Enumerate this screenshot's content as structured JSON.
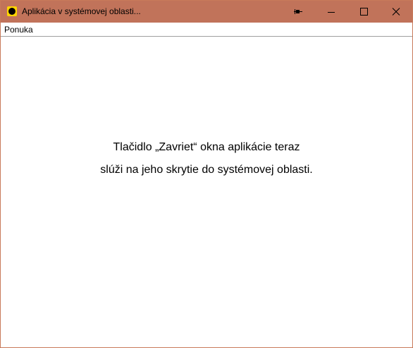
{
  "window": {
    "title": "Aplikácia v systémovej oblasti...",
    "title_bar_color": "#c1735a",
    "controls": [
      "pin-icon",
      "minimize-icon",
      "maximize-icon",
      "close-icon"
    ]
  },
  "menubar": {
    "items": [
      {
        "label": "Ponuka"
      }
    ]
  },
  "content": {
    "message_line_1": "Tlačidlo „Zavriet“ okna aplikácie teraz",
    "message_line_2": "slúži na jeho skrytie do systémovej oblasti."
  }
}
